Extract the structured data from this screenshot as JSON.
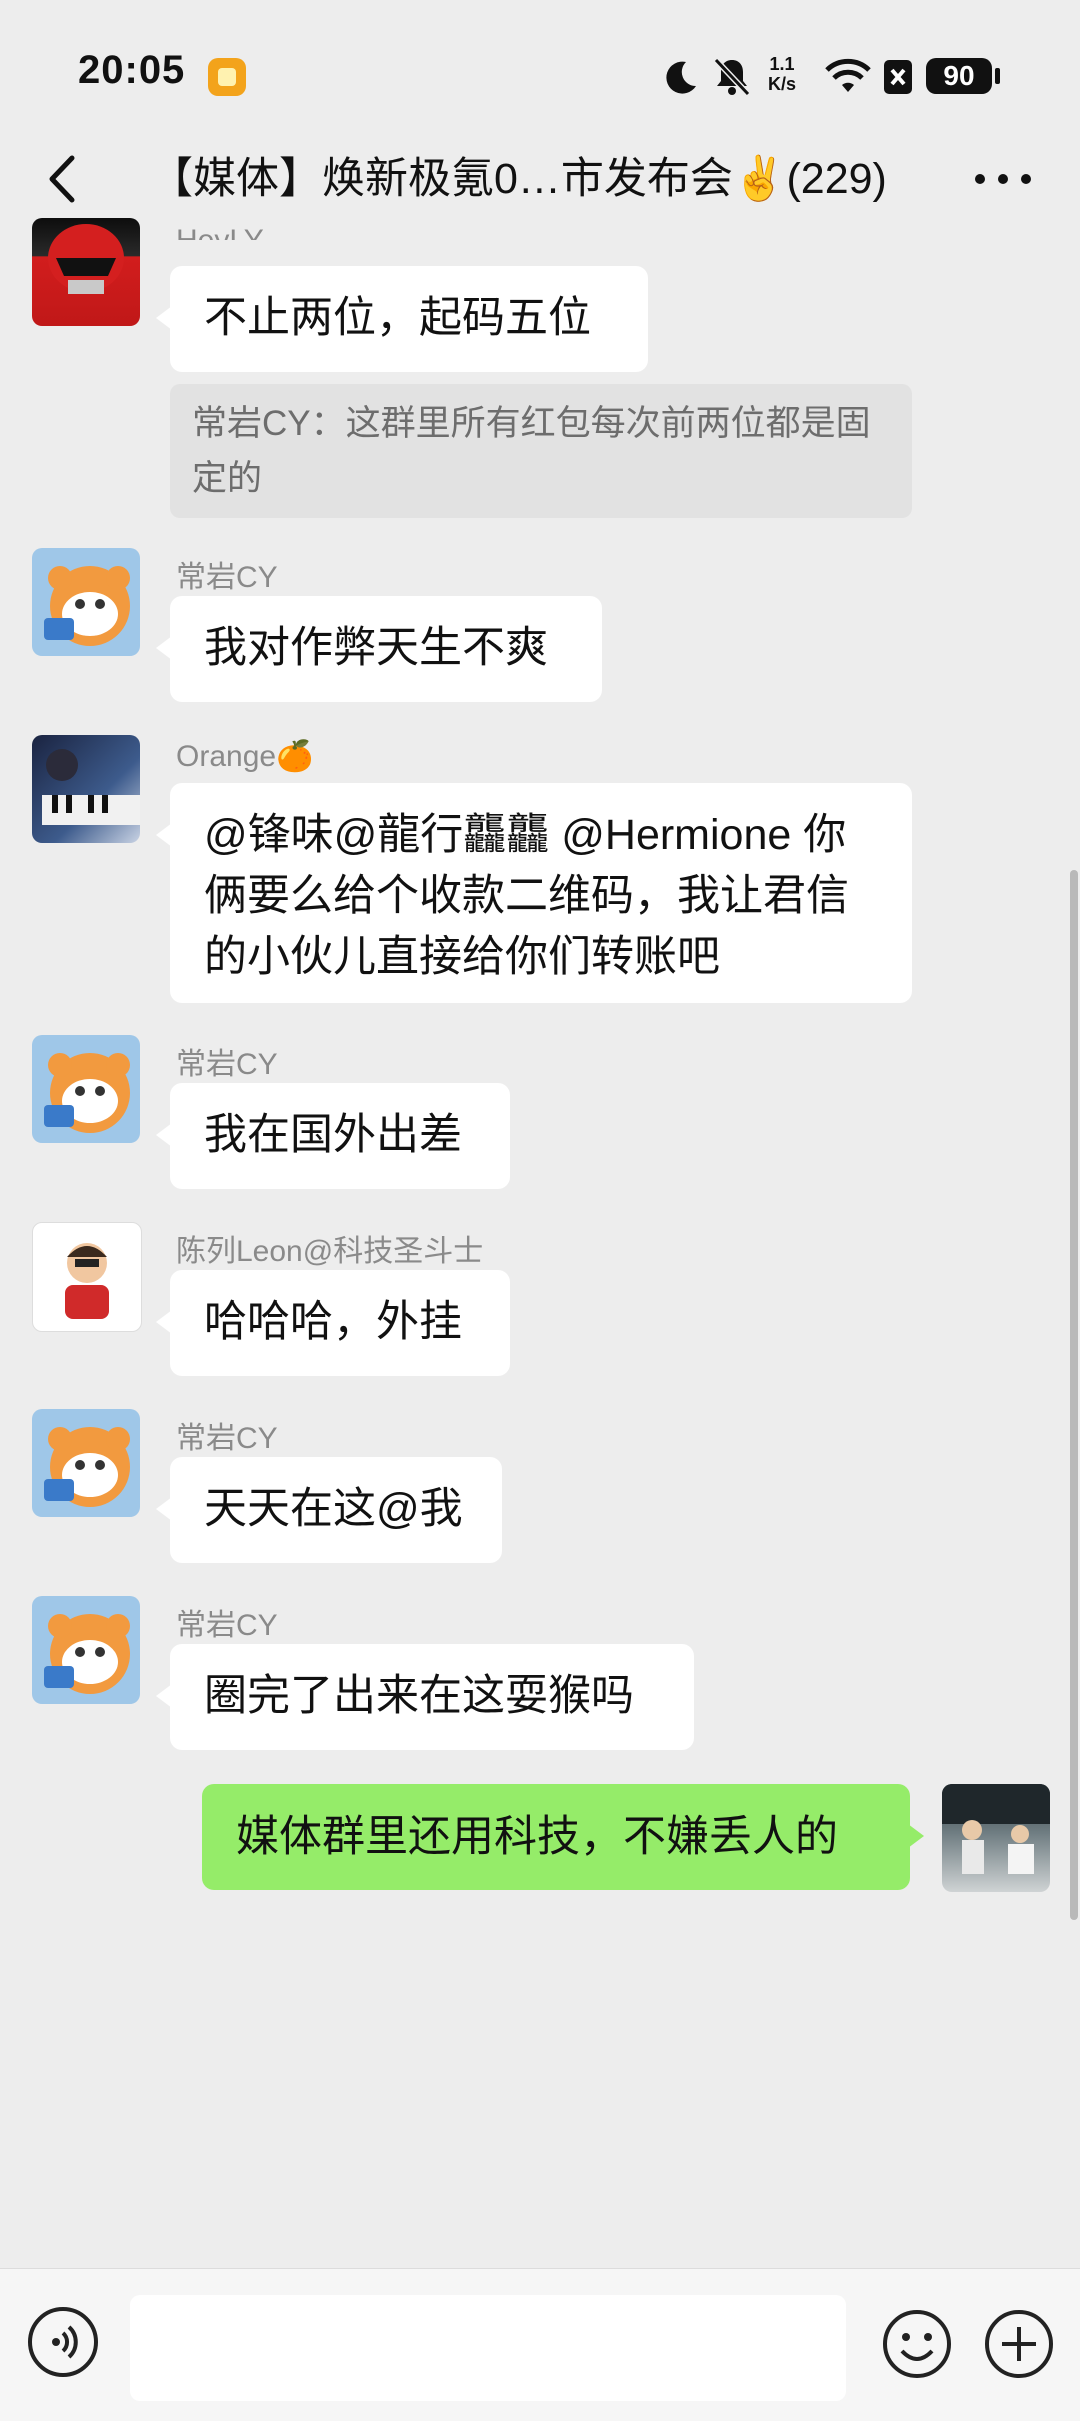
{
  "status_bar": {
    "time": "20:05",
    "net_speed_top": "1.1",
    "net_speed_bottom": "K/s",
    "battery": "90"
  },
  "header": {
    "title": "【媒体】焕新极氪0…市发布会✌️(229)"
  },
  "messages": [
    {
      "sender": "HeyLY",
      "text": "不止两位，起码五位",
      "quote": "常岩CY：这群里所有红包每次前两位都是固定的"
    },
    {
      "sender": "常岩CY",
      "text": "我对作弊天生不爽"
    },
    {
      "sender": "Orange🍊",
      "text": "@锋味@龍行龘龘 @Hermione 你俩要么给个收款二维码，我让君信的小伙儿直接给你们转账吧"
    },
    {
      "sender": "常岩CY",
      "text": "我在国外出差"
    },
    {
      "sender": "陈列Leon@科技圣斗士",
      "text": "哈哈哈，外挂"
    },
    {
      "sender": "常岩CY",
      "text": "天天在这@我"
    },
    {
      "sender": "常岩CY",
      "text": "圈完了出来在这耍猴吗"
    }
  ],
  "my_message": {
    "text": "媒体群里还用科技，不嫌丢人的"
  },
  "input": {
    "placeholder": ""
  },
  "icons": [
    "back-icon",
    "more-icon",
    "moon-icon",
    "mute-icon",
    "wifi-icon",
    "sim-icon",
    "voice-icon",
    "emoji-icon",
    "plus-icon"
  ],
  "colors": {
    "background": "#ededed",
    "my_bubble": "#95ec69",
    "other_bubble": "#ffffff"
  }
}
